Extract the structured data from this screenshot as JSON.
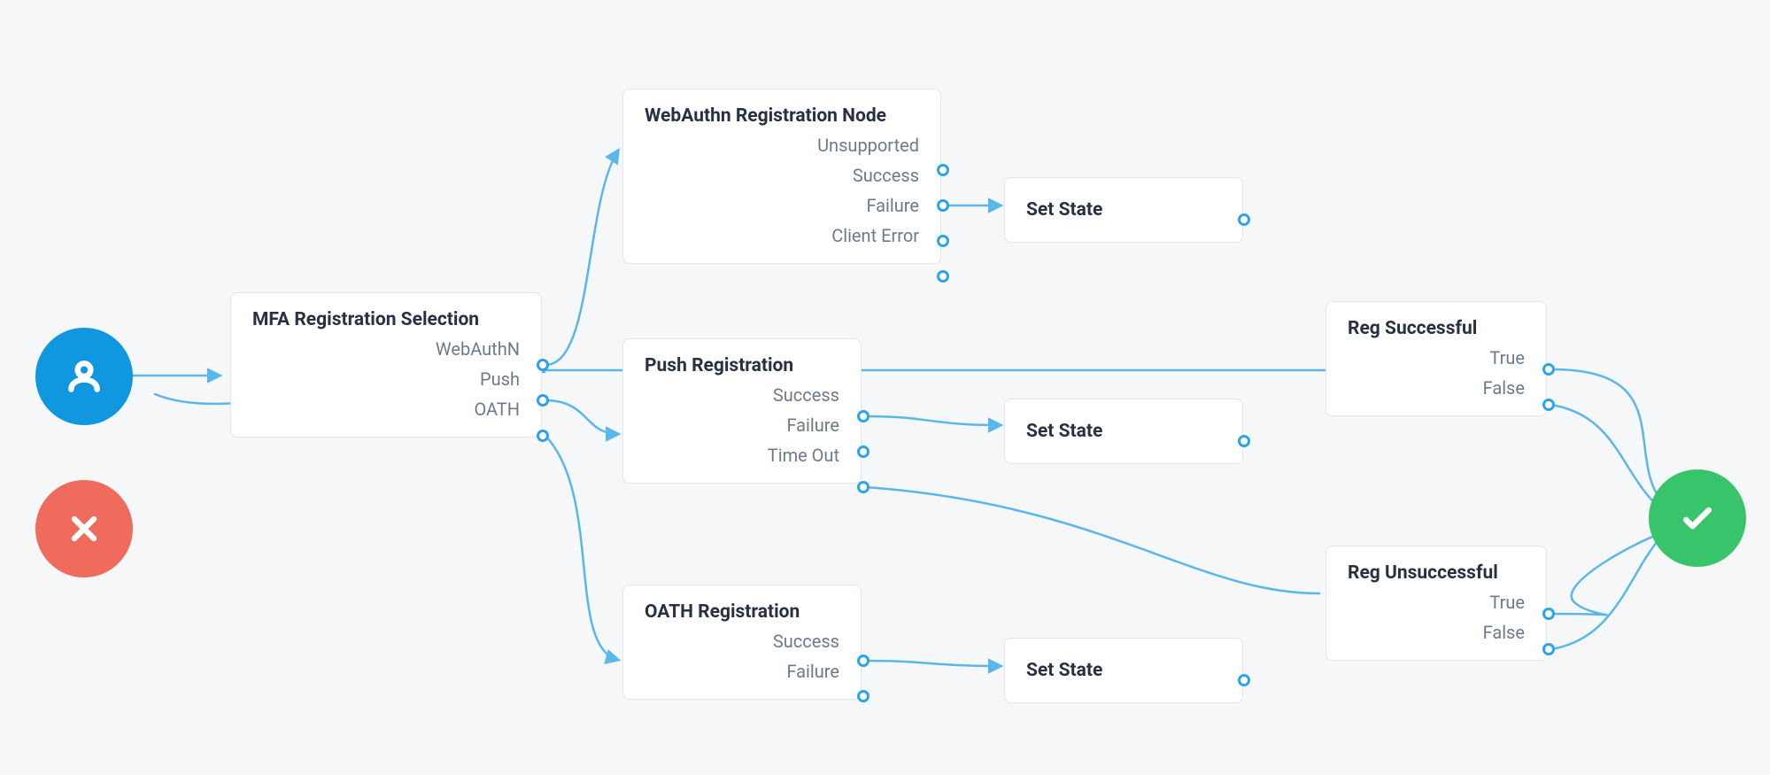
{
  "colors": {
    "background": "#f6f7f8",
    "cardBg": "#ffffff",
    "cardBorder": "#e3e6ea",
    "wire": "#5ab7ea",
    "port": "#2ea3e6",
    "start": "#0f97e0",
    "fail": "#ef6b5b",
    "success": "#37c46a",
    "text": "#273142",
    "muted": "#6c7a8a"
  },
  "icons": {
    "start": "person-icon",
    "fail": "x-icon",
    "success": "check-icon"
  },
  "nodes": {
    "mfa": {
      "title": "MFA Registration Selection",
      "outputs": [
        "WebAuthN",
        "Push",
        "OATH"
      ]
    },
    "webauthn": {
      "title": "WebAuthn Registration Node",
      "outputs": [
        "Unsupported",
        "Success",
        "Failure",
        "Client Error"
      ]
    },
    "push": {
      "title": "Push Registration",
      "outputs": [
        "Success",
        "Failure",
        "Time Out"
      ]
    },
    "oath": {
      "title": "OATH Registration",
      "outputs": [
        "Success",
        "Failure"
      ]
    },
    "setState1": {
      "title": "Set State"
    },
    "setState2": {
      "title": "Set State"
    },
    "setState3": {
      "title": "Set State"
    },
    "regSuccess": {
      "title": "Reg Successful",
      "outputs": [
        "True",
        "False"
      ]
    },
    "regUnsuccess": {
      "title": "Reg Unsuccessful",
      "outputs": [
        "True",
        "False"
      ]
    }
  },
  "edges": [
    {
      "from": "start",
      "to": "mfa.in"
    },
    {
      "from": "mfa.WebAuthN",
      "to": "webauthn.in"
    },
    {
      "from": "mfa.Push",
      "to": "push.in"
    },
    {
      "from": "mfa.OATH",
      "to": "oath.in"
    },
    {
      "from": "webauthn.Success",
      "to": "setState1.in"
    },
    {
      "from": "push.Success",
      "to": "setState2.in"
    },
    {
      "from": "oath.Success",
      "to": "setState3.in"
    },
    {
      "from": "webauthn.Success",
      "to": "regSuccess.in",
      "style": "long"
    },
    {
      "from": "push.TimeOut",
      "to": "regUnsuccess.in"
    },
    {
      "from": "regSuccess.True",
      "to": "success"
    },
    {
      "from": "regSuccess.False",
      "to": "success"
    },
    {
      "from": "regUnsuccess.True",
      "to": "success"
    },
    {
      "from": "regUnsuccess.False",
      "to": "success"
    },
    {
      "from": "start",
      "to": "mfa.in",
      "note": "loopback hint arc"
    }
  ]
}
